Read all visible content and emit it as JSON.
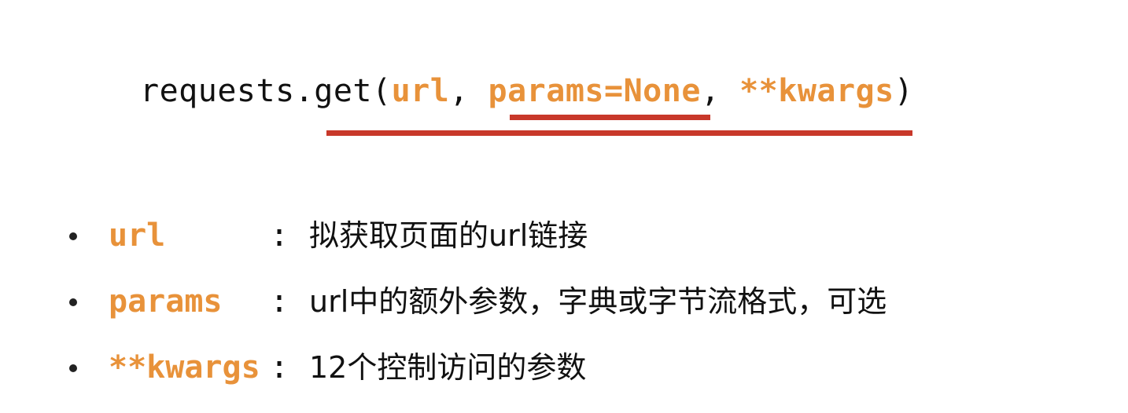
{
  "signature": {
    "prefix": "requests.get(",
    "arg_url": "url",
    "sep1": ", ",
    "arg_params": "params=None",
    "sep2": ", ",
    "arg_kwargs": "**kwargs",
    "suffix": ")"
  },
  "bullets": [
    {
      "name": "url",
      "colon": ":",
      "desc": "拟获取页面的url链接"
    },
    {
      "name": "params",
      "colon": ":",
      "desc": "url中的额外参数，字典或字节流格式，可选"
    },
    {
      "name": "**kwargs",
      "colon": ":",
      "desc": "12个控制访问的参数"
    }
  ],
  "colors": {
    "highlight": "#e8923a",
    "underline": "#c8382a",
    "text": "#111111"
  }
}
